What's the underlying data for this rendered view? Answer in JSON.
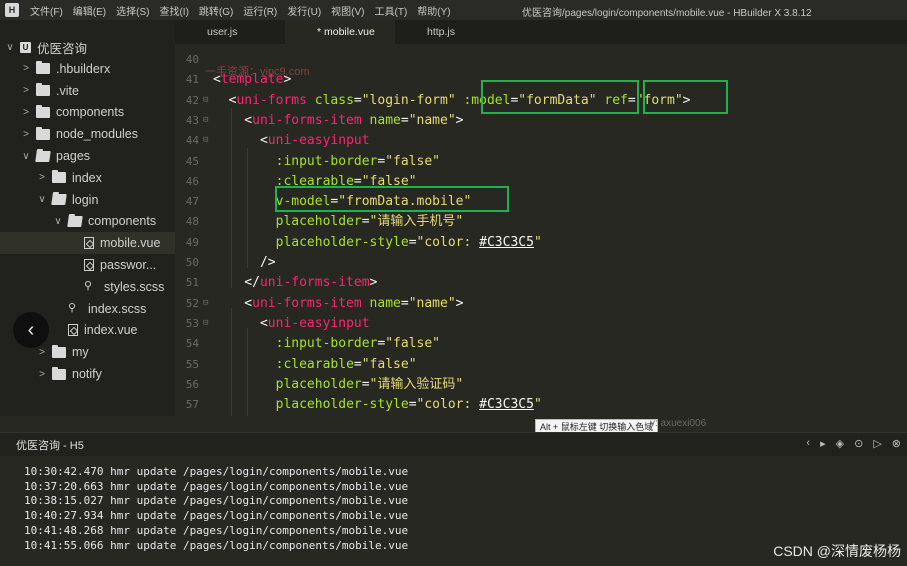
{
  "app": {
    "logo": "H",
    "menu": [
      "文件(F)",
      "编辑(E)",
      "选择(S)",
      "查找(I)",
      "跳转(G)",
      "运行(R)",
      "发行(U)",
      "视图(V)",
      "工具(T)",
      "帮助(Y)"
    ],
    "window_title": "优医咨询/pages/login/components/mobile.vue - HBuilder X 3.8.12"
  },
  "sidebar": {
    "tree": [
      {
        "label": "优医咨询",
        "chev": "∨",
        "icon": "proj"
      },
      {
        "label": ".hbuilderx",
        "chev": ">",
        "icon": "folder"
      },
      {
        "label": ".vite",
        "chev": ">",
        "icon": "folder"
      },
      {
        "label": "components",
        "chev": ">",
        "icon": "folder"
      },
      {
        "label": "node_modules",
        "chev": ">",
        "icon": "folder"
      },
      {
        "label": "pages",
        "chev": "∨",
        "icon": "folder"
      },
      {
        "label": "index",
        "chev": ">",
        "icon": "folder"
      },
      {
        "label": "login",
        "chev": "∨",
        "icon": "folder"
      },
      {
        "label": "components",
        "chev": "∨",
        "icon": "folder"
      },
      {
        "label": "mobile.vue",
        "chev": "",
        "icon": "vue"
      },
      {
        "label": "passwor...",
        "chev": "",
        "icon": "vue"
      },
      {
        "label": "styles.scss",
        "chev": "",
        "icon": "link"
      },
      {
        "label": "index.scss",
        "chev": "",
        "icon": "link"
      },
      {
        "label": "index.vue",
        "chev": "",
        "icon": "vue"
      },
      {
        "label": "my",
        "chev": ">",
        "icon": "folder"
      },
      {
        "label": "notify",
        "chev": ">",
        "icon": "folder"
      }
    ],
    "back_glyph": "‹",
    "toolbar_icons": [
      "▆",
      "⚭",
      "✲",
      "⟳",
      "⚙"
    ]
  },
  "tabs": [
    {
      "label": "user.js",
      "active": false
    },
    {
      "label": "* mobile.vue",
      "active": true
    },
    {
      "label": "http.js",
      "active": false
    }
  ],
  "editor": {
    "watermark": "一手资源：vipc9.com",
    "lines": [
      {
        "num": "40",
        "fold": "",
        "tokens": []
      },
      {
        "num": "41",
        "fold": "",
        "tokens": [
          [
            "punc",
            "<"
          ],
          [
            "tag",
            "template"
          ],
          [
            "punc",
            ">"
          ]
        ]
      },
      {
        "num": "42",
        "fold": "⊟",
        "tokens": [
          [
            "punc",
            "  <"
          ],
          [
            "tag",
            "uni-forms"
          ],
          [
            "punc",
            " "
          ],
          [
            "attr",
            "class"
          ],
          [
            "punc",
            "="
          ],
          [
            "str",
            "\"login-form\""
          ],
          [
            "punc",
            " "
          ],
          [
            "attr",
            ":model"
          ],
          [
            "punc",
            "="
          ],
          [
            "str",
            "\"formData\""
          ],
          [
            "punc",
            " "
          ],
          [
            "attr",
            "ref"
          ],
          [
            "punc",
            "="
          ],
          [
            "str",
            "\"form\""
          ],
          [
            "punc",
            ">"
          ]
        ]
      },
      {
        "num": "43",
        "fold": "⊟",
        "tokens": [
          [
            "punc",
            "    <"
          ],
          [
            "tag",
            "uni-forms-item"
          ],
          [
            "punc",
            " "
          ],
          [
            "attr",
            "name"
          ],
          [
            "punc",
            "="
          ],
          [
            "str",
            "\"name\""
          ],
          [
            "punc",
            ">"
          ]
        ]
      },
      {
        "num": "44",
        "fold": "⊟",
        "tokens": [
          [
            "punc",
            "      <"
          ],
          [
            "tag",
            "uni-easyinput"
          ]
        ]
      },
      {
        "num": "45",
        "fold": "",
        "tokens": [
          [
            "punc",
            "        "
          ],
          [
            "attr",
            ":input-border"
          ],
          [
            "punc",
            "="
          ],
          [
            "str",
            "\"false\""
          ]
        ]
      },
      {
        "num": "46",
        "fold": "",
        "tokens": [
          [
            "punc",
            "        "
          ],
          [
            "attr",
            ":clearable"
          ],
          [
            "punc",
            "="
          ],
          [
            "str",
            "\"false\""
          ]
        ]
      },
      {
        "num": "47",
        "fold": "",
        "tokens": [
          [
            "punc",
            "        "
          ],
          [
            "attr",
            "v-model"
          ],
          [
            "punc",
            "="
          ],
          [
            "str",
            "\"fromData.mobile\""
          ]
        ]
      },
      {
        "num": "48",
        "fold": "",
        "tokens": [
          [
            "punc",
            "        "
          ],
          [
            "attr",
            "placeholder"
          ],
          [
            "punc",
            "="
          ],
          [
            "str",
            "\"请输入手机号\""
          ]
        ]
      },
      {
        "num": "49",
        "fold": "",
        "tokens": [
          [
            "punc",
            "        "
          ],
          [
            "attr",
            "placeholder-style"
          ],
          [
            "punc",
            "="
          ],
          [
            "str",
            "\"color: "
          ],
          [
            "color",
            "#C3C3C5"
          ],
          [
            "str",
            "\""
          ]
        ]
      },
      {
        "num": "50",
        "fold": "",
        "tokens": [
          [
            "punc",
            "      />"
          ]
        ]
      },
      {
        "num": "51",
        "fold": "",
        "tokens": [
          [
            "punc",
            "    </"
          ],
          [
            "tag",
            "uni-forms-item"
          ],
          [
            "punc",
            ">"
          ]
        ]
      },
      {
        "num": "52",
        "fold": "⊟",
        "tokens": [
          [
            "punc",
            "    <"
          ],
          [
            "tag",
            "uni-forms-item"
          ],
          [
            "punc",
            " "
          ],
          [
            "attr",
            "name"
          ],
          [
            "punc",
            "="
          ],
          [
            "str",
            "\"name\""
          ],
          [
            "punc",
            ">"
          ]
        ]
      },
      {
        "num": "53",
        "fold": "⊟",
        "tokens": [
          [
            "punc",
            "      <"
          ],
          [
            "tag",
            "uni-easyinput"
          ]
        ]
      },
      {
        "num": "54",
        "fold": "",
        "tokens": [
          [
            "punc",
            "        "
          ],
          [
            "attr",
            ":input-border"
          ],
          [
            "punc",
            "="
          ],
          [
            "str",
            "\"false\""
          ]
        ]
      },
      {
        "num": "55",
        "fold": "",
        "tokens": [
          [
            "punc",
            "        "
          ],
          [
            "attr",
            ":clearable"
          ],
          [
            "punc",
            "="
          ],
          [
            "str",
            "\"false\""
          ]
        ]
      },
      {
        "num": "56",
        "fold": "",
        "tokens": [
          [
            "punc",
            "        "
          ],
          [
            "attr",
            "placeholder"
          ],
          [
            "punc",
            "="
          ],
          [
            "str",
            "\"请输入验证码\""
          ]
        ]
      },
      {
        "num": "57",
        "fold": "",
        "tokens": [
          [
            "punc",
            "        "
          ],
          [
            "attr",
            "placeholder-style"
          ],
          [
            "punc",
            "="
          ],
          [
            "str",
            "\"color: "
          ],
          [
            "color",
            "#C3C3C5"
          ],
          [
            "str",
            "\""
          ]
        ]
      }
    ],
    "bottom_watermark": "v: axuexi006"
  },
  "tooltip": {
    "text": "Alt + 鼠标左键 切换输入色域"
  },
  "console": {
    "tab_label": "优医咨询 - H5",
    "action_icons": [
      "‹",
      "▸",
      "◈",
      "⊙",
      "▷",
      "⊗"
    ],
    "logs": [
      "10:30:42.470 hmr update /pages/login/components/mobile.vue",
      "10:37:20.663 hmr update /pages/login/components/mobile.vue",
      "10:38:15.027 hmr update /pages/login/components/mobile.vue",
      "10:40:27.934 hmr update /pages/login/components/mobile.vue",
      "10:41:48.268 hmr update /pages/login/components/mobile.vue",
      "10:41:55.066 hmr update /pages/login/components/mobile.vue"
    ]
  },
  "csdn_watermark": "CSDN @深情废杨杨",
  "colors": {
    "highlight_box": "#22b14c",
    "tag": "#f92672",
    "attr": "#a6e22e",
    "string": "#e6db74"
  }
}
